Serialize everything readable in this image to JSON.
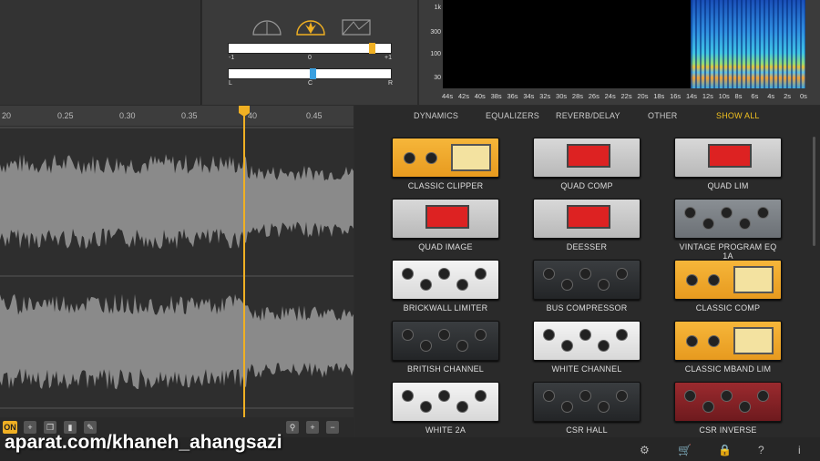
{
  "mode_icons": [
    "half-dial-icon",
    "burst-dial-icon",
    "waveform-box-icon"
  ],
  "balance_slider": {
    "min_label": "-1",
    "mid_label": "0",
    "max_label": "+1",
    "value_fraction": 0.9
  },
  "pan_slider": {
    "left_label": "L",
    "center_label": "C",
    "right_label": "R",
    "value_fraction": 0.52
  },
  "spectrogram": {
    "freq_labels": [
      "1k",
      "300",
      "100",
      "30"
    ],
    "time_labels": [
      "44s",
      "42s",
      "40s",
      "38s",
      "36s",
      "34s",
      "32s",
      "30s",
      "28s",
      "26s",
      "24s",
      "22s",
      "20s",
      "18s",
      "16s",
      "14s",
      "12s",
      "10s",
      "8s",
      "6s",
      "4s",
      "2s",
      "0s"
    ]
  },
  "timeline": {
    "labels": [
      "20",
      "0.25",
      "0.30",
      "0.35",
      "40",
      "0.45"
    ]
  },
  "wave_toolbar": {
    "on_label": "ON",
    "left_icons": [
      "plus-icon",
      "copy-icon",
      "trash-icon",
      "edit-icon"
    ],
    "right_icons": [
      "zoom-icon",
      "zoom-in-icon",
      "zoom-out-icon"
    ]
  },
  "filters": [
    {
      "label": "DYNAMICS"
    },
    {
      "label": "EQUALIZERS"
    },
    {
      "label": "REVERB/DELAY"
    },
    {
      "label": "OTHER"
    },
    {
      "label": "SHOW ALL",
      "active": true
    }
  ],
  "plugins": [
    {
      "name": "CLASSIC CLIPPER",
      "style": "gold"
    },
    {
      "name": "QUAD COMP",
      "style": "red"
    },
    {
      "name": "QUAD LIM",
      "style": "red"
    },
    {
      "name": "QUAD IMAGE",
      "style": "red"
    },
    {
      "name": "DEESSER",
      "style": "red"
    },
    {
      "name": "VINTAGE PROGRAM EQ 1A",
      "style": "grey"
    },
    {
      "name": "BRICKWALL LIMITER",
      "style": "white"
    },
    {
      "name": "BUS COMPRESSOR",
      "style": "dark"
    },
    {
      "name": "CLASSIC COMP",
      "style": "gold"
    },
    {
      "name": "BRITISH CHANNEL",
      "style": "dark"
    },
    {
      "name": "WHITE CHANNEL",
      "style": "white"
    },
    {
      "name": "CLASSIC MBAND LIM",
      "style": "gold"
    },
    {
      "name": "WHITE 2A",
      "style": "white"
    },
    {
      "name": "CSR HALL",
      "style": "dark"
    },
    {
      "name": "CSR INVERSE",
      "style": "crimson"
    }
  ],
  "status_icons": [
    "gear-icon",
    "cart-icon",
    "lock-icon",
    "help-icon",
    "info-icon"
  ],
  "status_glyphs": [
    "⚙",
    "🛒",
    "🔒",
    "?",
    "i"
  ],
  "watermark": "aparat.com/khaneh_ahangsazi",
  "colors": {
    "accent": "#f0b023",
    "waveform": "#8a8a8a"
  }
}
